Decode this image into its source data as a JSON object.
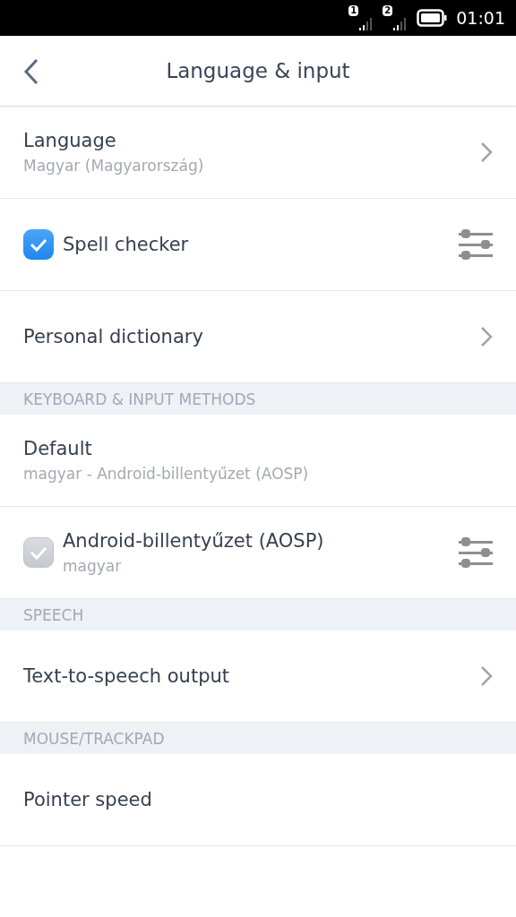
{
  "status_bar": {
    "sims": [
      "1",
      "2"
    ],
    "time": "01:01"
  },
  "header": {
    "title": "Language & input"
  },
  "sections": [
    {
      "items": [
        {
          "kind": "link",
          "title": "Language",
          "subtitle": "Magyar (Magyarország)"
        },
        {
          "kind": "checkbox",
          "title": "Spell checker",
          "checked": true,
          "disabled": false
        },
        {
          "kind": "link",
          "title": "Personal dictionary"
        }
      ]
    },
    {
      "heading": "KEYBOARD & INPUT METHODS",
      "items": [
        {
          "kind": "plain",
          "title": "Default",
          "subtitle": "magyar - Android-billentyűzet (AOSP)"
        },
        {
          "kind": "checkbox",
          "title": "Android-billentyűzet (AOSP)",
          "subtitle": "magyar",
          "checked": true,
          "disabled": true
        }
      ]
    },
    {
      "heading": "SPEECH",
      "items": [
        {
          "kind": "link",
          "title": "Text-to-speech output"
        }
      ]
    },
    {
      "heading": "MOUSE/TRACKPAD",
      "items": [
        {
          "kind": "plain",
          "title": "Pointer speed"
        }
      ]
    }
  ]
}
